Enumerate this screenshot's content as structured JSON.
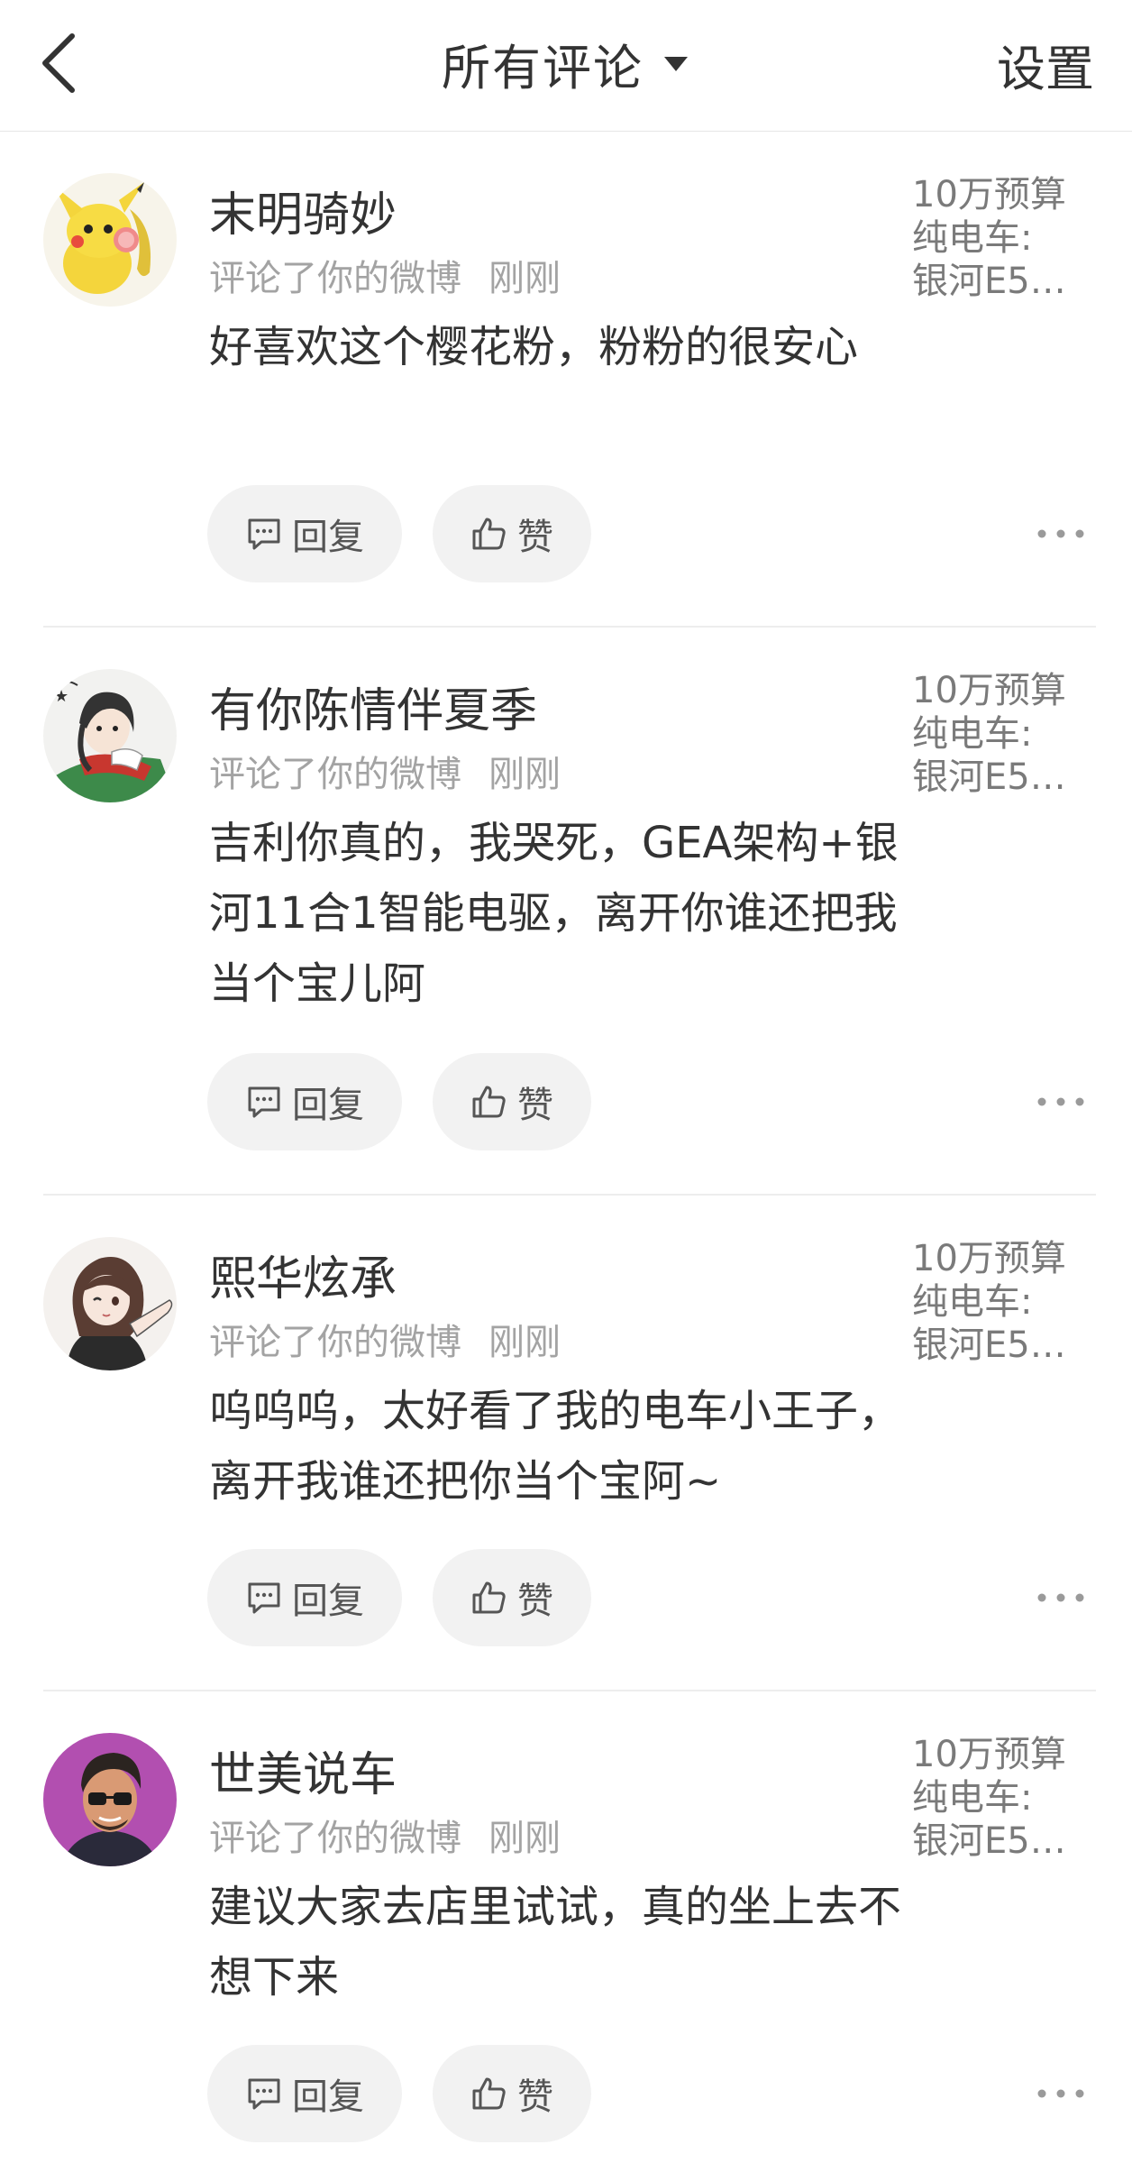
{
  "header": {
    "title": "所有评论",
    "settings_label": "设置"
  },
  "comments": [
    {
      "username": "末明骑妙",
      "action": "评论了你的微博",
      "time": "刚刚",
      "content": "好喜欢这个樱花粉，粉粉的很安心",
      "ref_line1": "10万预算",
      "ref_line2": "纯电车:",
      "ref_line3": "银河E5…",
      "reply_label": "回复",
      "like_label": "赞"
    },
    {
      "username": "有你陈情伴夏季",
      "action": "评论了你的微博",
      "time": "刚刚",
      "content": "吉利你真的，我哭死，GEA架构+银河11合1智能电驱，离开你谁还把我当个宝儿阿",
      "ref_line1": "10万预算",
      "ref_line2": "纯电车:",
      "ref_line3": "银河E5…",
      "reply_label": "回复",
      "like_label": "赞"
    },
    {
      "username": "熙华炫承",
      "action": "评论了你的微博",
      "time": "刚刚",
      "content": "呜呜呜，太好看了我的电车小王子，离开我谁还把你当个宝阿~",
      "ref_line1": "10万预算",
      "ref_line2": "纯电车:",
      "ref_line3": "银河E5…",
      "reply_label": "回复",
      "like_label": "赞"
    },
    {
      "username": "世美说车",
      "action": "评论了你的微博",
      "time": "刚刚",
      "content": "建议大家去店里试试，真的坐上去不想下来",
      "ref_line1": "10万预算",
      "ref_line2": "纯电车:",
      "ref_line3": "银河E5…",
      "reply_label": "回复",
      "like_label": "赞"
    }
  ]
}
